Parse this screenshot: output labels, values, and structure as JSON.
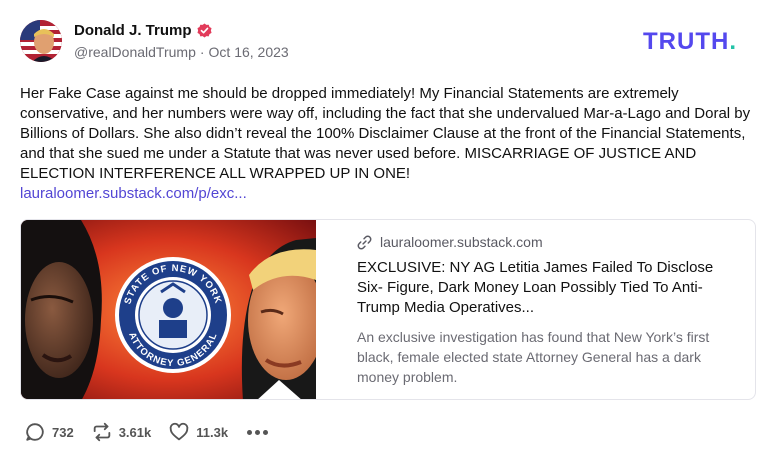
{
  "author": {
    "name": "Donald J. Trump",
    "handle": "@realDonaldTrump",
    "separator": "·",
    "date": "Oct 16, 2023",
    "avatar_icon": "avatar-flag-portrait",
    "verified_icon": "verified-badge-icon"
  },
  "brand": {
    "logo_text": "TRUTH.",
    "color": "#5448ee",
    "dot_color": "#23c3a7"
  },
  "post": {
    "text": "Her Fake Case against me should be dropped immediately! My Financial Statements are extremely conservative, and her numbers were way off, including the fact that she undervalued Mar-a-Lago and Doral by Billions of Dollars. She also didn’t reveal the 100% Disclaimer Clause at the front of the Financial Statements, and that she sued me under a Statute that was never used before. MISCARRIAGE OF JUSTICE AND ELECTION INTERFERENCE ALL WRAPPED UP IN ONE!",
    "link": "lauraloomer.substack.com/p/exc..."
  },
  "card": {
    "domain": "lauraloomer.substack.com",
    "title": "EXCLUSIVE: NY AG Letitia James Failed To Disclose Six- Figure, Dark Money Loan Possibly Tied To Anti-Trump Media Operatives...",
    "description": "An exclusive investigation has found that New York’s first black, female elected state Attorney General has a dark money problem.",
    "seal_text_top": "STATE OF NEW YORK",
    "seal_text_bottom": "ATTORNEY GENERAL",
    "link_icon": "link-icon"
  },
  "actions": {
    "replies": "732",
    "retruths": "3.61k",
    "likes": "11.3k",
    "reply_icon": "comment-icon",
    "retruth_icon": "repost-icon",
    "like_icon": "heart-icon",
    "more_icon": "more-dots-icon"
  }
}
